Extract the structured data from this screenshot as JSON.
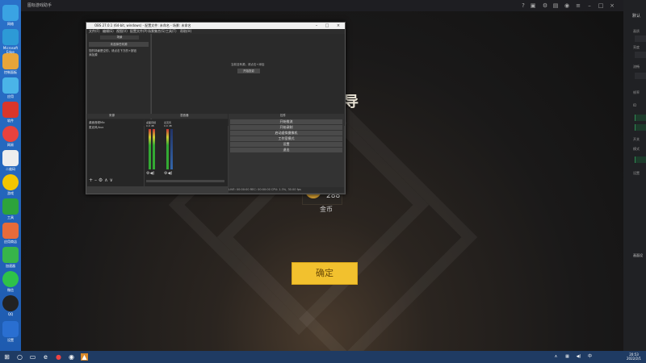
{
  "desktop": {
    "icons": [
      {
        "label": "网络",
        "color": "#3aa3e3",
        "icon": "network-icon"
      },
      {
        "label": "Microsoft Edge",
        "color": "#2d9ad6",
        "icon": "edge-icon"
      },
      {
        "label": "控制面板",
        "color": "#e7a53a",
        "icon": "control-panel-icon"
      },
      {
        "label": "应用",
        "color": "#4ab4e8",
        "icon": "app-icon"
      },
      {
        "label": "软件",
        "color": "#d9362b",
        "icon": "software-icon"
      },
      {
        "label": "网易",
        "color": "#e8423d",
        "icon": "netease-icon"
      },
      {
        "label": "二维码",
        "color": "#eeeeee",
        "icon": "qr-icon"
      },
      {
        "label": "游戏",
        "color": "#f2c500",
        "icon": "game-icon"
      },
      {
        "label": "工具",
        "color": "#2da33b",
        "icon": "tool-icon"
      },
      {
        "label": "应用商店",
        "color": "#e66b3a",
        "icon": "store-icon"
      },
      {
        "label": "加速器",
        "color": "#37b54a",
        "icon": "accelerator-icon"
      },
      {
        "label": "微信",
        "color": "#2ec24a",
        "icon": "wechat-icon"
      },
      {
        "label": "QQ",
        "color": "#222222",
        "icon": "qq-icon"
      },
      {
        "label": "设置",
        "color": "#2a6fd1",
        "icon": "settings-icon"
      }
    ]
  },
  "game": {
    "title": "图标游戏助手",
    "coin_value": "288",
    "coin_label": "金币",
    "confirm_label": "确定",
    "heading_glyph": "导"
  },
  "right_panel": {
    "header": "默认",
    "items": [
      "画质",
      "亮度",
      "流畅",
      "帧率",
      "ID",
      "开关",
      "模式",
      "设置"
    ],
    "bottom_label": "画面设"
  },
  "obs": {
    "title": "OBS 27.0.1 (64-bit, windows) - 配置文件: 未命名 - 场景: 未命名",
    "menu": [
      "文件(F)",
      "编辑(E)",
      "视图(V)",
      "配置文件(P)",
      "场景集合(S)",
      "工具(T)",
      "帮助(H)"
    ],
    "scene_header": "场景",
    "scene_item": "未选择任何源",
    "scene_note": "您的场景是空的，请点击下方的+按钮添加源",
    "preview_text": "当前没有源，请点击+添加",
    "preview_button": "开始投影",
    "panel_bar_left": "未选择源",
    "panel_bar_right": "属性",
    "panel_bar_filter": "滤镜",
    "sources_head": "来源",
    "mixer_head": "混音器",
    "sources": [
      "桌面音频Mic",
      "麦克风/Aux"
    ],
    "mixer_labels": [
      "桌面音频",
      "麦克风"
    ],
    "mixer_db": [
      "0.0 dB",
      "0.0 dB"
    ],
    "controls_head": "控件",
    "controls": [
      "开始推流",
      "开始录制",
      "启动虚拟摄像机",
      "工作室模式",
      "设置",
      "退出"
    ],
    "status": "LIVE: 00:00:00   REC: 00:00:00   CPU: 1.3%, 30.00 fps"
  },
  "taskbar": {
    "time": "20:53",
    "date": "2022/2/1"
  }
}
